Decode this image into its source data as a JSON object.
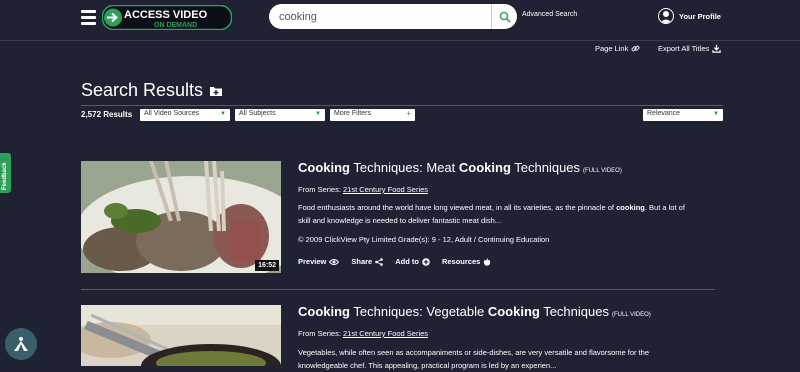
{
  "header": {
    "logo_line1": "ACCESS VIDEO",
    "logo_line2": "ON DEMAND",
    "search_value": "cooking",
    "advanced_search": "Advanced Search",
    "profile_label": "Your Profile"
  },
  "toolbar": {
    "page_link": "Page Link",
    "export": "Export All Titles"
  },
  "search": {
    "title": "Search Results",
    "count": "2,572 Results",
    "filters": [
      "All Video Sources",
      "All Subjects",
      "More Filters"
    ],
    "sort": "Relevance"
  },
  "feedback": "Feedback",
  "results": [
    {
      "title_parts": [
        "Cooking",
        " Techniques: Meat ",
        "Cooking",
        " Techniques"
      ],
      "tag": "(FULL VIDEO)",
      "series_prefix": "From Series: ",
      "series": "21st Century Food Series",
      "desc_a": "Food enthusiasts around the world have long viewed meat, in all its varieties, as the pinnacle of ",
      "desc_b": "cooking",
      "desc_c": ". But a lot of skill and knowledge is needed to deliver fantastic meat dish...",
      "copyright": "© 2009 ClickView Pty Limited Grade(s): 9 - 12, Adult / Continuing Education",
      "duration": "16:52"
    },
    {
      "title_parts": [
        "Cooking",
        " Techniques: Vegetable ",
        "Cooking",
        " Techniques"
      ],
      "tag": "(FULL VIDEO)",
      "series_prefix": "From Series: ",
      "series": "21st Century Food Series",
      "desc": "Vegetables, while often seen as accompaniments or side-dishes, are very versatile and flavorsome for the knowledgeable chef. This appealing, practical program is led by an experien..."
    }
  ],
  "actions": {
    "preview": "Preview",
    "share": "Share",
    "add_to": "Add to",
    "resources": "Resources"
  },
  "colors": {
    "background": "#1f2233",
    "accent_green": "#2e9e5b"
  }
}
